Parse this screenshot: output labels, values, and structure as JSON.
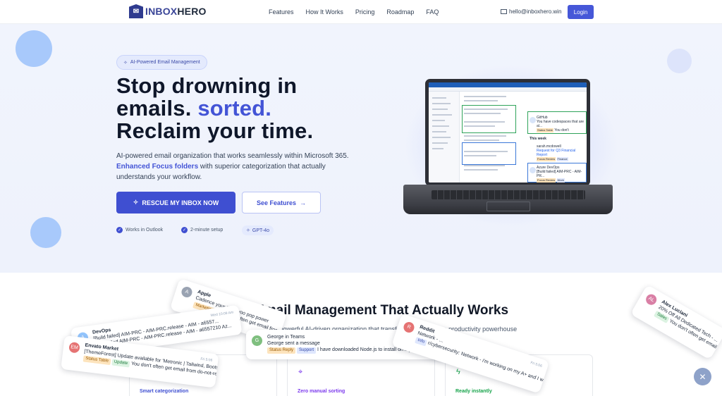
{
  "nav": {
    "logo_prefix": "INBOX",
    "logo_suffix": "HERO",
    "links": [
      "Features",
      "How It Works",
      "Pricing",
      "Roadmap",
      "FAQ"
    ],
    "email": "hello@inboxhero.win",
    "login": "Login"
  },
  "hero": {
    "badge": "AI-Powered Email Management",
    "headline_line1": "Stop drowning in",
    "headline_line2a": "emails.",
    "headline_line2b": "sorted.",
    "headline_line3": "Reclaim your time.",
    "sub_part1": "AI-powered email organization that works seamlessly within Microsoft 365.",
    "sub_strong": "Enhanced Focus folders",
    "sub_part2": "with superior categorization that actually understands your workflow.",
    "cta_primary": "RESCUE MY INBOX NOW",
    "cta_secondary": "See Features",
    "features": [
      "Works in Outlook",
      "2-minute setup"
    ],
    "gpt_badge": "GPT-4o"
  },
  "laptop_screen": {
    "card1_title": "GitHub",
    "card1_text": "You have codespaces that are al...",
    "section": "This week",
    "card2_title": "sarah.mcdowell",
    "card2_text": "Request for Q3 Financial Report",
    "card3_title": "Azure DevOps",
    "card3_text": "[Build failed] AIM-PRC - AIM-PR...",
    "tag_status": "Status Table",
    "tag_review": "Focus Review",
    "tag_wait": "Work",
    "tag_finance": "Finance",
    "card1_extra": "You don't"
  },
  "section": {
    "title": "Smart Email Management That Actually Works",
    "subtitle": "Transform your inbox with powerful AI-driven organization that transforms chaos into a productivity powerhouse"
  },
  "feature_cards": [
    {
      "label": "Smart categorization",
      "color": "#3f4fd1"
    },
    {
      "label": "Zero manual sorting",
      "color": "#7c3aed"
    },
    {
      "label": "Ready instantly",
      "color": "#16a34a"
    }
  ],
  "toasts": {
    "apple": {
      "initial": "A",
      "title": "Apple",
      "line": "Cadence your tie to yoo pop power",
      "tag": "Marketing",
      "body": "You don't often get email from..."
    },
    "devops": {
      "initial": "A",
      "title": "DevOps",
      "time": "Wed 10:09 Am",
      "line": "[Build failed] AIM-PRC - AIM-PRC.release - AIM - a6557...",
      "body": "Build failed AIM-PRC - AIM-PRC.release - AIM - a6557210 Az..."
    },
    "envato": {
      "initial": "EM",
      "title": "Envato Market",
      "time": "Fri 5:06",
      "line": "[ThemeForest] Update available for 'Metronic | Tailwind, Bootstrap...",
      "tag1": "Status Table",
      "tag2": "Update",
      "body": "You don't often get email from do-not-reply@market..."
    },
    "george": {
      "initial": "G",
      "title": "George in Teams",
      "line": "George sent a message",
      "tag1": "Status Reply",
      "tag2": "Support",
      "body": "I have downloaded Node.js to install on my laptop..."
    },
    "reddit": {
      "initial": "R",
      "title": "Reddit",
      "time": "Fri 5:06",
      "line": "Network - ...",
      "tag": "Info",
      "body": "r/cybersecurity: Network - i'm working on my A+ and I was planning..."
    },
    "alex": {
      "initial": "AL",
      "title": "Alex Luciani",
      "line": "20% Off All Dedicated Tech - ...",
      "tag": "Sales",
      "body": "You don't often get email from..."
    }
  }
}
